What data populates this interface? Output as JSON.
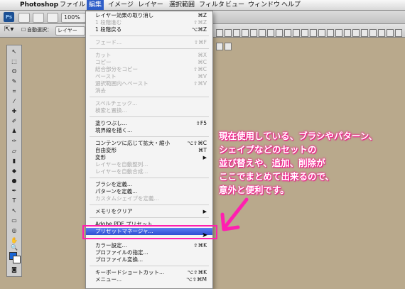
{
  "menubar": {
    "app": "Photoshop",
    "items": [
      "ファイル",
      "編集",
      "イメージ",
      "レイヤー",
      "選択範囲",
      "フィルタ",
      "ビュー",
      "ウィンドウ",
      "ヘルプ"
    ]
  },
  "appbar": {
    "logo": "Ps",
    "zoom": "100%"
  },
  "options": {
    "auto_select": "自動選択：",
    "auto_select_value": "レイヤー"
  },
  "edit_menu": {
    "items": [
      {
        "label": "レイヤー効果の取り消し",
        "shortcut": "⌘Z"
      },
      {
        "label": "1 段階進む",
        "shortcut": "⇧⌘Z",
        "disabled": true
      },
      {
        "label": "1 段階戻る",
        "shortcut": "⌥⌘Z"
      },
      {
        "label": "フェード...",
        "shortcut": "⇧⌘F",
        "disabled": true
      },
      {
        "label": "カット",
        "shortcut": "⌘X",
        "disabled": true
      },
      {
        "label": "コピー",
        "shortcut": "⌘C",
        "disabled": true
      },
      {
        "label": "結合部分をコピー",
        "shortcut": "⇧⌘C",
        "disabled": true
      },
      {
        "label": "ペースト",
        "shortcut": "⌘V",
        "disabled": true
      },
      {
        "label": "選択範囲内へペースト",
        "shortcut": "⇧⌘V",
        "disabled": true
      },
      {
        "label": "消去",
        "shortcut": "",
        "disabled": true
      },
      {
        "label": "スペルチェック...",
        "shortcut": "",
        "disabled": true
      },
      {
        "label": "検索と置換...",
        "shortcut": "",
        "disabled": true
      },
      {
        "label": "塗りつぶし...",
        "shortcut": "⇧F5"
      },
      {
        "label": "境界線を描く...",
        "shortcut": ""
      },
      {
        "label": "コンテンツに応じて拡大・縮小",
        "shortcut": "⌥⇧⌘C"
      },
      {
        "label": "自由変形",
        "shortcut": "⌘T"
      },
      {
        "label": "変形",
        "shortcut": ""
      },
      {
        "label": "レイヤーを自動整列...",
        "shortcut": "",
        "disabled": true
      },
      {
        "label": "レイヤーを自動合成...",
        "shortcut": "",
        "disabled": true
      },
      {
        "label": "ブラシを定義...",
        "shortcut": ""
      },
      {
        "label": "パターンを定義...",
        "shortcut": ""
      },
      {
        "label": "カスタムシェイプを定義...",
        "shortcut": "",
        "disabled": true
      },
      {
        "label": "メモリをクリア",
        "shortcut": ""
      },
      {
        "label": "Adobe PDF プリセット...",
        "shortcut": ""
      },
      {
        "label": "プリセットマネージャ...",
        "shortcut": "",
        "highlighted": true
      },
      {
        "label": "カラー設定...",
        "shortcut": "⇧⌘K"
      },
      {
        "label": "プロファイルの指定...",
        "shortcut": ""
      },
      {
        "label": "プロファイル変換...",
        "shortcut": ""
      },
      {
        "label": "キーボードショートカット...",
        "shortcut": "⌥⇧⌘K"
      },
      {
        "label": "メニュー...",
        "shortcut": "⌥⇧⌘M"
      }
    ]
  },
  "callout": {
    "lines": [
      "現在使用している、ブラシやパターン、",
      "シェイプなどのセットの",
      "並び替えや、追加、削除が",
      "ここでまとめて出来るので、",
      "意外と便利です。"
    ]
  },
  "colors": {
    "accent": "#ff1fb0",
    "menu_highlight": "#3a5bdc",
    "canvas": "#b9a98c"
  }
}
